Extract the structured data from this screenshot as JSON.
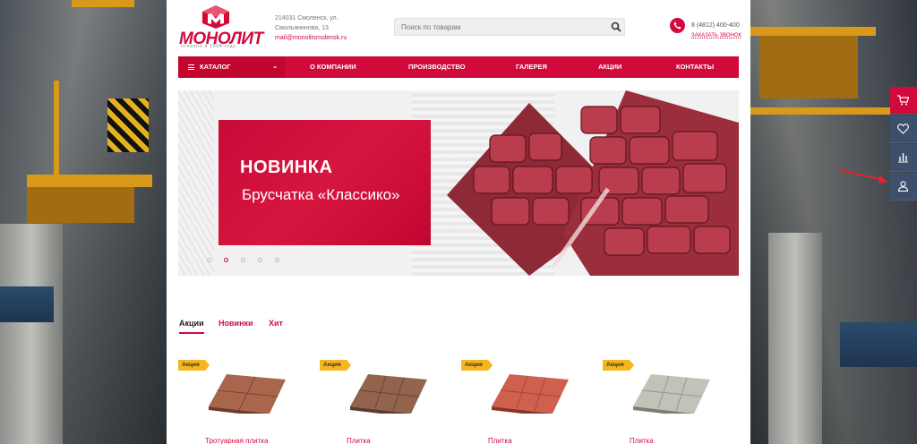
{
  "logo": {
    "name": "МОНОЛИТ",
    "tagline": "отлично в 1998 году"
  },
  "contacts": {
    "address_line1": "214031 Смоленск, ул.",
    "address_line2": "Смольянинова, 13",
    "email": "mail@monolitsmolensk.ru",
    "phone": "8 (4812) 400-400",
    "callback": "ЗАКАЗАТЬ ЗВОНОК"
  },
  "search": {
    "placeholder": "Поиск по товарам"
  },
  "nav": {
    "catalog": "КАТАЛОГ",
    "items": [
      "О КОМПАНИИ",
      "ПРОИЗВОДСТВО",
      "ГАЛЕРЕЯ",
      "АКЦИИ",
      "КОНТАКТЫ"
    ]
  },
  "slider": {
    "title": "НОВИНКА",
    "subtitle": "Брусчатка «Классико»",
    "active_slide": 2,
    "slide_count": 5
  },
  "tabs": [
    "Акции",
    "Новинки",
    "Хит"
  ],
  "products": [
    {
      "badge": "Акция",
      "name": "Тротуарная плитка",
      "color": "#9c5a44"
    },
    {
      "badge": "Акция",
      "name": "Плитка",
      "color": "#8b5a44"
    },
    {
      "badge": "Акция",
      "name": "Плитка",
      "color": "#c75a4a"
    },
    {
      "badge": "Акция",
      "name": "Плитка",
      "color": "#b9b8ae"
    }
  ],
  "sidepanel": [
    "cart-icon",
    "heart-icon",
    "chart-icon",
    "user-icon"
  ],
  "colors": {
    "brand": "#d20a3c",
    "badge": "#f5b51d",
    "panel": "#3d4f6b"
  }
}
